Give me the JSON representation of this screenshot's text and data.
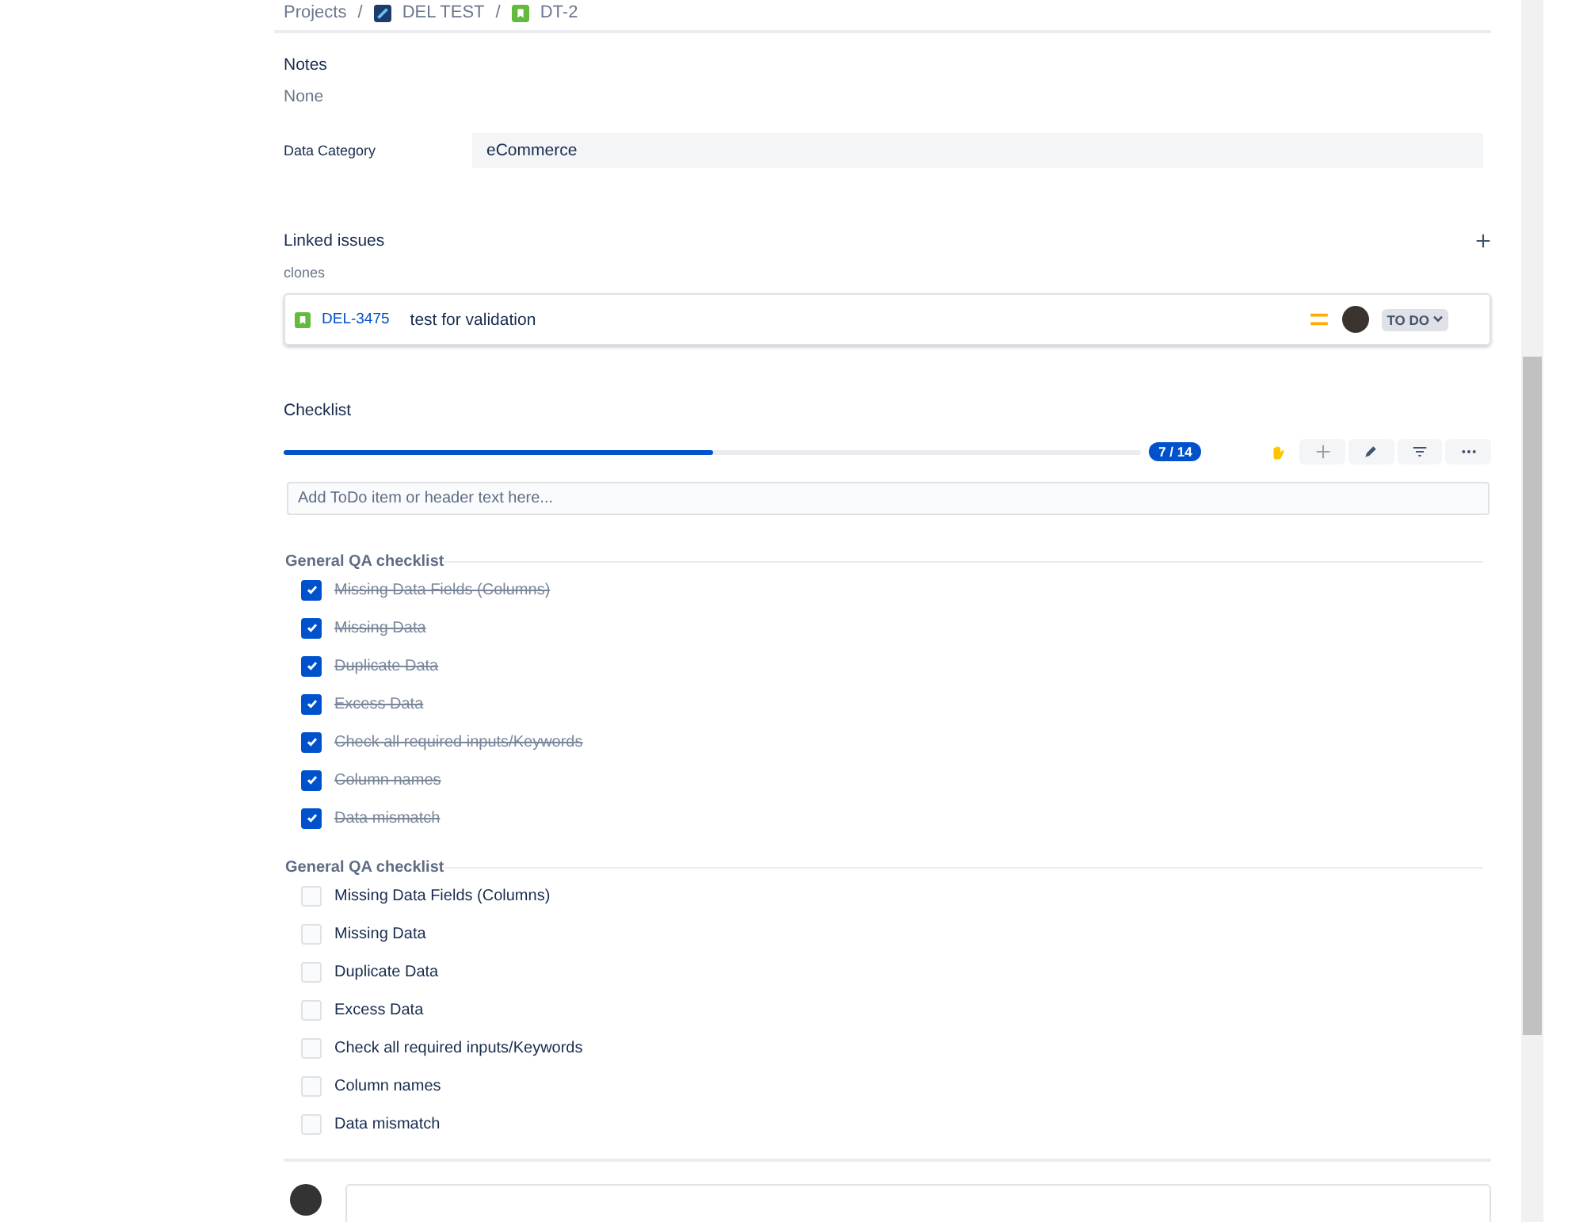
{
  "breadcrumbs": [
    {
      "kind": "text",
      "label": "Projects"
    },
    {
      "kind": "project",
      "separator": "/",
      "label": "DEL TEST"
    },
    {
      "kind": "story",
      "separator": "/",
      "label": "DT-2"
    }
  ],
  "notes": {
    "label": "Notes",
    "value": "None"
  },
  "data_category": {
    "label": "Data Category",
    "value": "eCommerce"
  },
  "linked_issues": {
    "title": "Linked issues",
    "relation": "clones",
    "issues": [
      {
        "key": "DEL-3475",
        "summary": "test for validation",
        "status": "TO DO"
      }
    ]
  },
  "checklist": {
    "title": "Checklist",
    "level": 0.5,
    "progress": "7 / 14",
    "placeholder": "Add ToDo item or header text here...",
    "groups": [
      {
        "header": "General QA checklist",
        "items": [
          {
            "label": "Missing Data Fields (Columns)",
            "checked": true
          },
          {
            "label": "Missing Data",
            "checked": true
          },
          {
            "label": "Duplicate Data",
            "checked": true
          },
          {
            "label": "Excess Data",
            "checked": true
          },
          {
            "label": "Check all required inputs/Keywords",
            "checked": true
          },
          {
            "label": "Column names",
            "checked": true
          },
          {
            "label": "Data mismatch",
            "checked": true
          }
        ]
      },
      {
        "header": "General QA checklist",
        "items": [
          {
            "label": "Missing Data Fields (Columns)",
            "checked": false
          },
          {
            "label": "Missing Data",
            "checked": false
          },
          {
            "label": "Duplicate Data",
            "checked": false
          },
          {
            "label": "Excess Data",
            "checked": false
          },
          {
            "label": "Check all required inputs/Keywords",
            "checked": false
          },
          {
            "label": "Column names",
            "checked": false
          },
          {
            "label": "Data mismatch",
            "checked": false
          }
        ]
      }
    ]
  }
}
